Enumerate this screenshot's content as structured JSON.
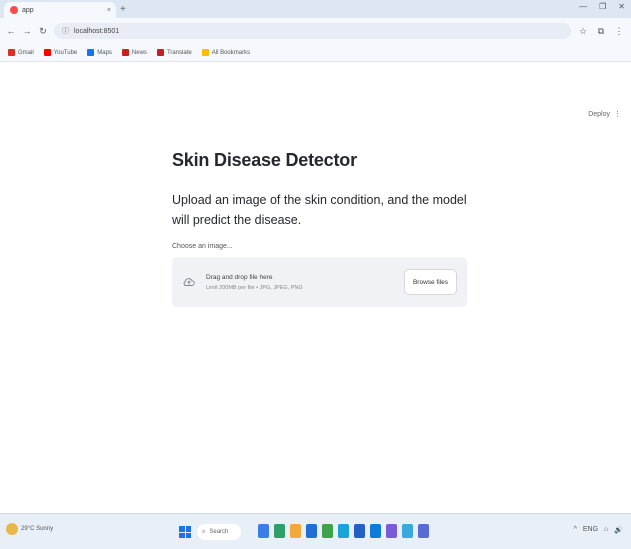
{
  "browser": {
    "tab_title": "app",
    "tab_close": "×",
    "new_tab": "+",
    "window_controls": [
      "—",
      "❐",
      "✕"
    ],
    "nav": [
      "←",
      "→",
      "↻"
    ],
    "url": "localhost:8501",
    "toolbar_icons": [
      "☆",
      "⧉",
      "⋮"
    ],
    "bookmarks": [
      {
        "label": "Gmail",
        "color": "#d93025"
      },
      {
        "label": "YouTube",
        "color": "#ff0000"
      },
      {
        "label": "Maps",
        "color": "#1a73e8"
      },
      {
        "label": "News",
        "color": "#c5221f"
      },
      {
        "label": "Translate",
        "color": "#c5221f"
      },
      {
        "label": "All Bookmarks",
        "color": "#fbbc04"
      }
    ]
  },
  "page": {
    "deploy_label": "Deploy",
    "deploy_menu": "⋮",
    "title": "Skin Disease Detector",
    "description": "Upload an image of the skin condition, and the model will predict the disease.",
    "uploader_label": "Choose an image...",
    "dropzone_main": "Drag and drop file here",
    "dropzone_sub": "Limit 200MB per file • JPG, JPEG, PNG",
    "browse_label": "Browse files"
  },
  "taskbar": {
    "weather": "29°C Sunny",
    "search_placeholder": "Search",
    "apps": [
      "#3c7ee8",
      "#2f9e6a",
      "#f0a93b",
      "#1f6fd6",
      "#3fa34d",
      "#19a3d8",
      "#2561c4",
      "#0f7bd8",
      "#7a5cd6",
      "#3ba8e0",
      "#5a6cd3"
    ],
    "tray_items": [
      "^",
      "ENG",
      "⌂",
      "🔊"
    ]
  },
  "colors": {
    "accent": "#ff4b4b",
    "text": "#262730",
    "dropzone_bg": "#f0f2f6"
  }
}
